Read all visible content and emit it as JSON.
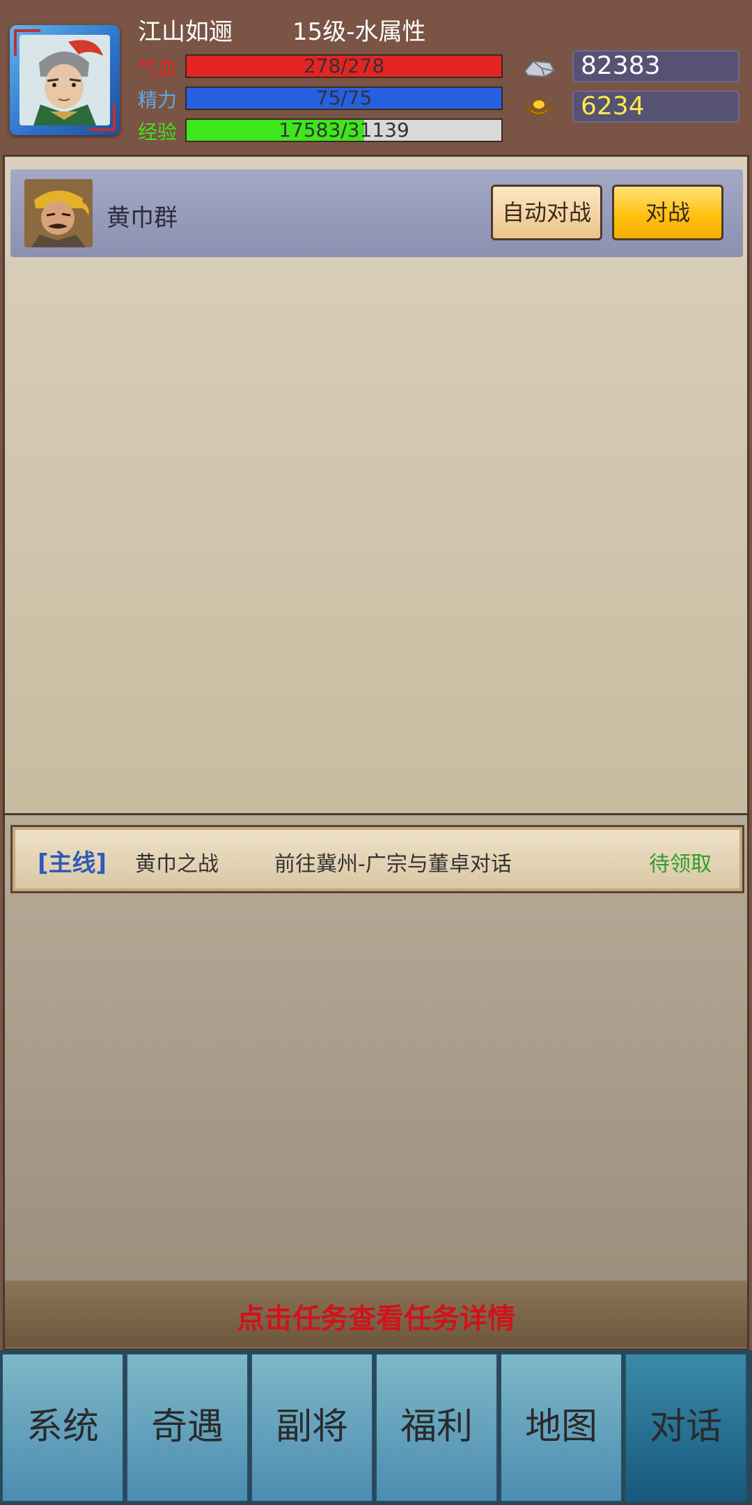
{
  "player": {
    "name": "江山如逦",
    "level_info": "15级-水属性"
  },
  "stats": {
    "hp": {
      "label": "气血",
      "text": "278/278",
      "fraction": 1.0,
      "color": "#e42424",
      "label_color": "#e02424"
    },
    "energy": {
      "label": "精力",
      "text": "75/75",
      "fraction": 1.0,
      "color": "#2560e0",
      "label_color": "#5fa9e6"
    },
    "exp": {
      "label": "经验",
      "text": "17583/31139",
      "fraction": 0.565,
      "color": "#3ee61c",
      "label_color": "#3ee61c"
    }
  },
  "resources": {
    "silver": {
      "value": "82383",
      "icon": "silver-ingot-icon",
      "color": "#ffffff"
    },
    "gold": {
      "value": "6234",
      "icon": "gold-yuanbao-icon",
      "color": "#ffe94a"
    }
  },
  "enemy": {
    "name": "黄巾群",
    "auto_battle_label": "自动对战",
    "battle_label": "对战"
  },
  "quest": {
    "tag": "[主线]",
    "name": "黄巾之战",
    "description": "前往冀州-广宗与董卓对话",
    "status": "待领取"
  },
  "hint": "点击任务查看任务详情",
  "nav": [
    {
      "label": "系统",
      "active": false
    },
    {
      "label": "奇遇",
      "active": false
    },
    {
      "label": "副将",
      "active": false
    },
    {
      "label": "福利",
      "active": false
    },
    {
      "label": "地图",
      "active": false
    },
    {
      "label": "对话",
      "active": true
    }
  ]
}
